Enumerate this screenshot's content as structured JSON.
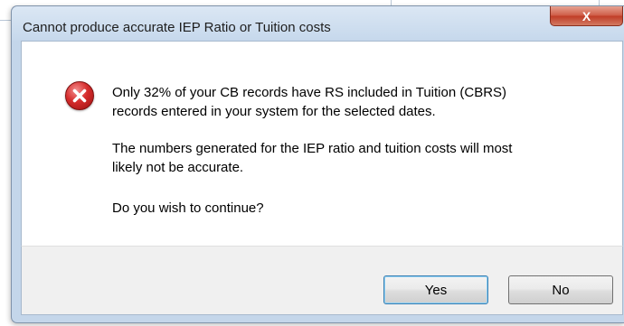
{
  "dialog": {
    "title": "Cannot produce accurate IEP Ratio or Tuition costs",
    "close_label": "X",
    "icon": "error-icon",
    "message": {
      "line1": "Only 32% of your CB records have RS included in Tuition (CBRS)",
      "line2": "records entered in your system for the selected dates.",
      "line3": "The numbers generated for the IEP ratio and tuition costs will most",
      "line4": "likely not be accurate.",
      "line5": "Do you wish to continue?"
    },
    "buttons": {
      "yes": "Yes",
      "no": "No"
    }
  },
  "colors": {
    "frame": "#c4d6ea",
    "close_button": "#c84c36",
    "error_red": "#d52c2c",
    "default_button_border": "#3c7fb1"
  }
}
